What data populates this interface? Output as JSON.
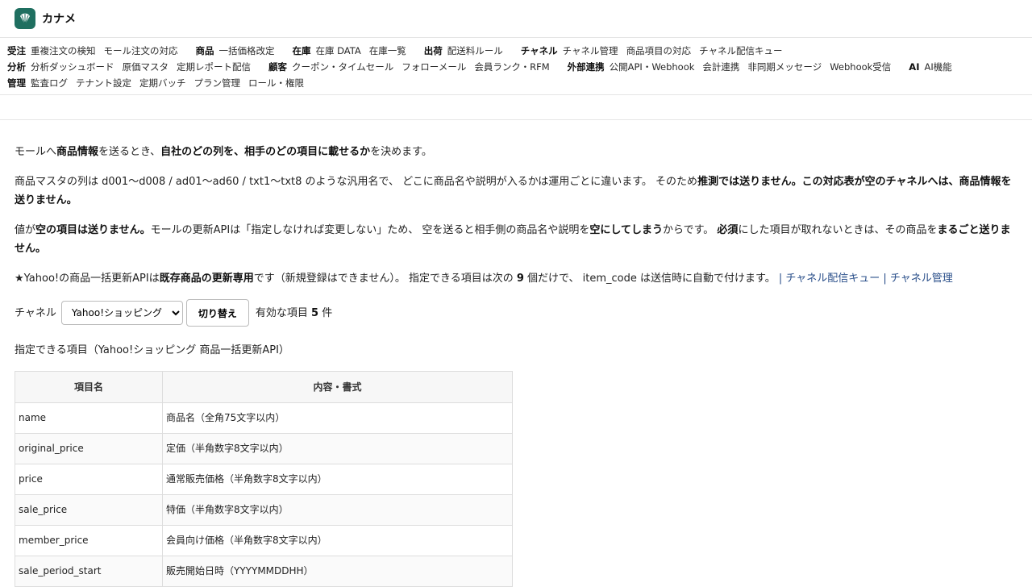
{
  "app": {
    "name": "カナメ"
  },
  "nav": {
    "rows": [
      [
        {
          "head": "受注",
          "links": [
            "重複注文の検知",
            "モール注文の対応"
          ]
        },
        {
          "head": "商品",
          "links": [
            "一括価格改定"
          ]
        },
        {
          "head": "在庫",
          "links": [
            "在庫 DATA",
            "在庫一覧"
          ]
        },
        {
          "head": "出荷",
          "links": [
            "配送料ルール"
          ]
        },
        {
          "head": "チャネル",
          "links": [
            "チャネル管理",
            "商品項目の対応",
            "チャネル配信キュー"
          ]
        }
      ],
      [
        {
          "head": "分析",
          "links": [
            "分析ダッシュボード",
            "原価マスタ",
            "定期レポート配信"
          ]
        },
        {
          "head": "顧客",
          "links": [
            "クーポン・タイムセール",
            "フォローメール",
            "会員ランク・RFM"
          ]
        },
        {
          "head": "外部連携",
          "links": [
            "公開API・Webhook",
            "会計連携",
            "非同期メッセージ",
            "Webhook受信"
          ]
        },
        {
          "head": "AI",
          "links": [
            "AI機能"
          ]
        }
      ],
      [
        {
          "head": "管理",
          "links": [
            "監査ログ",
            "テナント設定",
            "定期バッチ",
            "プラン管理",
            "ロール・権限"
          ]
        }
      ]
    ]
  },
  "intro": {
    "p1": [
      "モールへ",
      "商品情報",
      "を送るとき、",
      "自社のどの列を、相手のどの項目に載せるか",
      "を決めます。"
    ],
    "p2": [
      "商品マスタの列は d001〜d008 / ad01〜ad60 / txt1〜txt8 のような汎用名で、 どこに商品名や説明が入るかは運用ごとに違います。 そのため",
      "推測では送りません。この対応表が空のチャネルへは、商品情報を送りません。"
    ],
    "p3": [
      "値が",
      "空の項目は送りません。",
      "モールの更新APIは「指定しなければ変更しない」ため、 空を送ると相手側の商品名や説明を",
      "空にしてしまう",
      "からです。 ",
      "必須",
      "にした項目が取れないときは、その商品を",
      "まるごと送りません。"
    ],
    "p4": [
      "★Yahoo!の商品一括更新APIは",
      "既存商品の更新専用",
      "です（新規登録はできません）。 指定できる項目は次の ",
      "9",
      " 個だけで、 item_code は送信時に自動で付けます。 ",
      "| チャネル配信キュー",
      " ",
      "| チャネル管理"
    ]
  },
  "controls": {
    "channel_label": "チャネル",
    "channel_selected": "Yahoo!ショッピング",
    "switch_button": "切り替え",
    "valid_prefix": "有効な項目 ",
    "valid_count": "5",
    "valid_suffix": " 件"
  },
  "table": {
    "caption": "指定できる項目（Yahoo!ショッピング 商品一括更新API）",
    "headers": [
      "項目名",
      "内容・書式"
    ],
    "rows": [
      [
        "name",
        "商品名（全角75文字以内）"
      ],
      [
        "original_price",
        "定価（半角数字8文字以内）"
      ],
      [
        "price",
        "通常販売価格（半角数字8文字以内）"
      ],
      [
        "sale_price",
        "特価（半角数字8文字以内）"
      ],
      [
        "member_price",
        "会員向け価格（半角数字8文字以内）"
      ],
      [
        "sale_period_start",
        "販売開始日時（YYYYMMDDHH）"
      ]
    ]
  }
}
